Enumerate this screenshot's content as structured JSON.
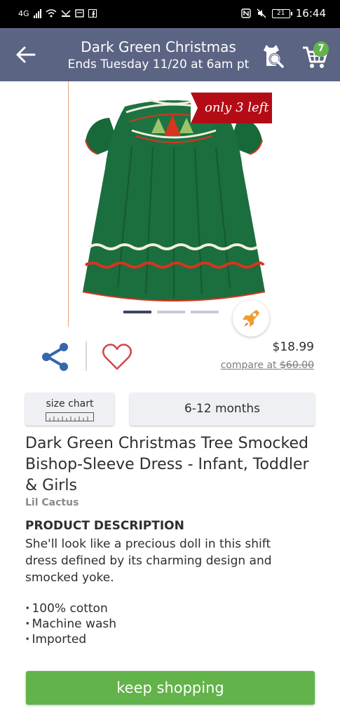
{
  "status_bar": {
    "network": "4G",
    "battery": "21",
    "time": "16:44"
  },
  "header": {
    "title": "Dark Green Christmas",
    "subtitle": "Ends Tuesday 11/20 at 6am pt",
    "cart_count": "7"
  },
  "image": {
    "stock_label": "only 3 left",
    "active_slide": 1,
    "slide_count": 3
  },
  "pricing": {
    "price": "$18.99",
    "compare_label": "compare at",
    "compare_price": "$60.00"
  },
  "size": {
    "chart_label": "size chart",
    "selected": "6-12 months"
  },
  "product": {
    "title": "Dark Green Christmas Tree Smocked Bishop-Sleeve Dress - Infant, Toddler & Girls",
    "brand": "Lil Cactus",
    "description_heading": "PRODUCT DESCRIPTION",
    "description": "She'll look like a precious doll in this shift dress defined by its charming design and smocked yoke.",
    "features": [
      "100% cotton",
      "Machine wash",
      "Imported"
    ]
  },
  "footer": {
    "keep_shopping": "keep shopping"
  },
  "colors": {
    "header": "#5c6483",
    "accent_green": "#62b349",
    "stock_red": "#b30c16",
    "dress_green": "#1a6b3c"
  }
}
